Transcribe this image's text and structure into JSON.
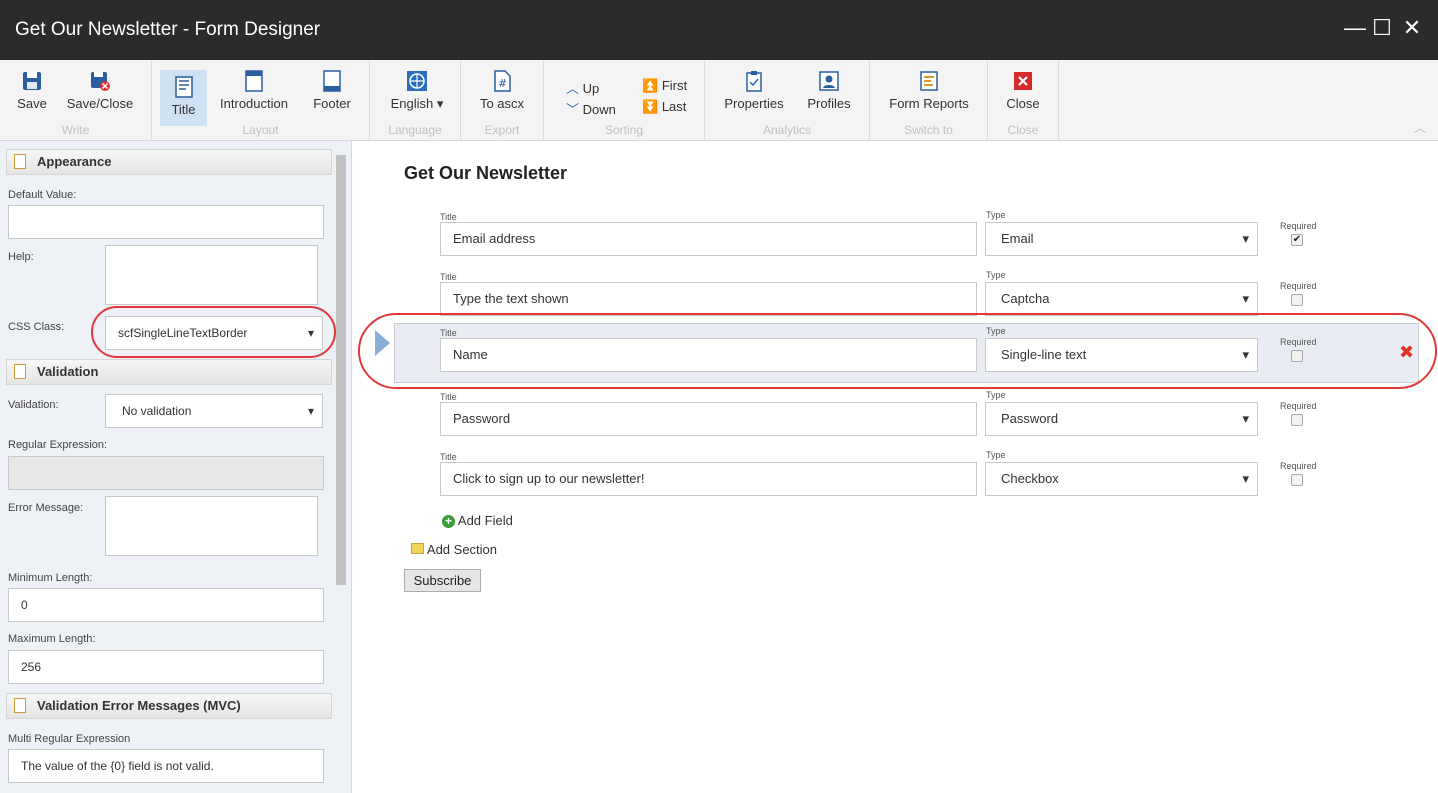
{
  "window": {
    "title": "Get Our Newsletter - Form Designer",
    "minimize": "—",
    "maximize": "☐",
    "close": "✕"
  },
  "ribbon": {
    "save": "Save",
    "save_close": "Save/Close",
    "write": "Write",
    "title": "Title",
    "introduction": "Introduction",
    "footer": "Footer",
    "layout": "Layout",
    "english": "English ▾",
    "language": "Language",
    "to_ascx": "To ascx",
    "export": "Export",
    "up": "Up",
    "down": "Down",
    "first": "First",
    "last": "Last",
    "sorting": "Sorting",
    "properties": "Properties",
    "profiles": "Profiles",
    "analytics": "Analytics",
    "form_reports": "Form Reports",
    "switch_to": "Switch to",
    "close": "Close",
    "close_grp": "Close"
  },
  "left": {
    "appearance": "Appearance",
    "default_value_label": "Default Value:",
    "default_value": "",
    "help_label": "Help:",
    "css_class_label": "CSS Class:",
    "css_class": "scfSingleLineTextBorder",
    "validation_head": "Validation",
    "validation_label": "Validation:",
    "validation": "No validation",
    "regex_label": "Regular Expression:",
    "error_msg_label": "Error Message:",
    "min_len_label": "Minimum Length:",
    "min_len": "0",
    "max_len_label": "Maximum Length:",
    "max_len": "256",
    "mvc_head": "Validation Error Messages (MVC)",
    "multi_regex_label": "Multi Regular Expression",
    "multi_regex": "The value of the {0} field is not valid."
  },
  "form": {
    "heading": "Get Our Newsletter",
    "title_label": "Title",
    "type_label": "Type",
    "required_label": "Required",
    "fields": [
      {
        "title": "Email address",
        "type": "Email",
        "required": true
      },
      {
        "title": "Type the text shown",
        "type": "Captcha",
        "required": false
      },
      {
        "title": "Name",
        "type": "Single-line text",
        "required": false
      },
      {
        "title": "Password",
        "type": "Password",
        "required": false
      },
      {
        "title": "Click to sign up to our newsletter!",
        "type": "Checkbox",
        "required": false
      }
    ],
    "add_field": "Add Field",
    "add_section": "Add Section",
    "submit": "Subscribe"
  },
  "colors": {
    "accent": "#2a6ebb",
    "highlight": "#e03a3a",
    "titlebar": "#2b2b2b"
  }
}
